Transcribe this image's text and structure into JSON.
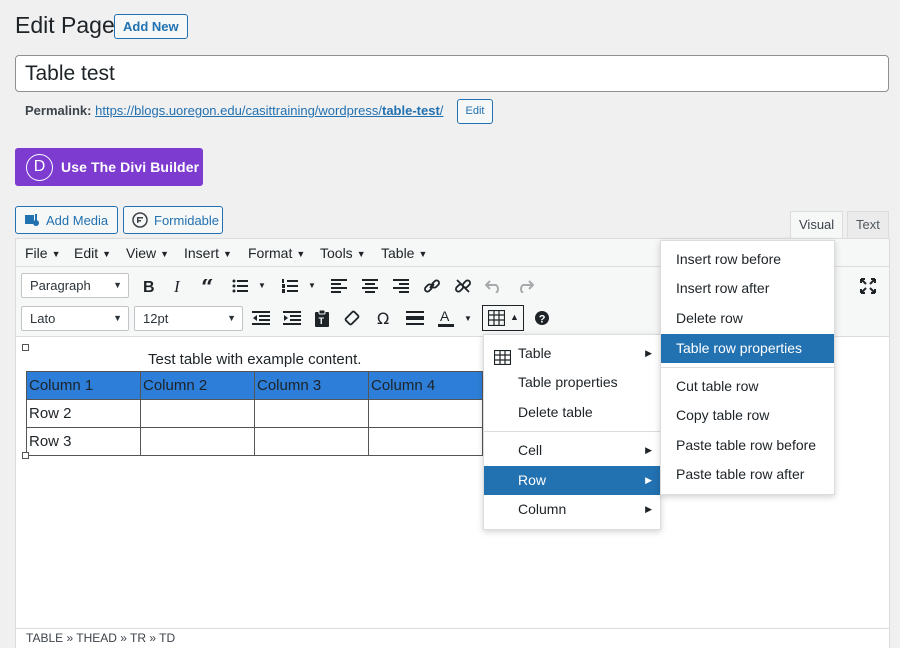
{
  "header": {
    "title": "Edit Page",
    "add_new_label": "Add New"
  },
  "post": {
    "title_value": "Table test",
    "permalink_label": "Permalink:",
    "permalink_base": "https://blogs.uoregon.edu/casittraining/wordpress/",
    "permalink_slug": "table-test",
    "permalink_trailing": "/",
    "edit_slug_label": "Edit"
  },
  "divi": {
    "logo_letter": "D",
    "label": "Use The Divi Builder",
    "color": "#7e3bd0"
  },
  "media_buttons": {
    "add_media": "Add Media",
    "formidable": "Formidable"
  },
  "editor_tabs": {
    "visual": "Visual",
    "text": "Text"
  },
  "menubar": {
    "items": [
      "File",
      "Edit",
      "View",
      "Insert",
      "Format",
      "Tools",
      "Table"
    ]
  },
  "toolbar": {
    "format_select": "Paragraph",
    "font_family_select": "Lato",
    "font_size_select": "12pt"
  },
  "content": {
    "caption": "Test table with example content.",
    "rows": [
      [
        "Column 1",
        "Column 2",
        "Column 3",
        "Column 4"
      ],
      [
        "Row 2",
        "",
        "",
        ""
      ],
      [
        "Row 3",
        "",
        "",
        ""
      ]
    ],
    "header_color": "#2d7ed8"
  },
  "table_menu": {
    "items": [
      {
        "label": "Table",
        "icon": "table-icon",
        "has_submenu": true
      },
      {
        "label": "Table properties"
      },
      {
        "label": "Delete table"
      },
      {
        "label": "Cell",
        "has_submenu": true
      },
      {
        "label": "Row",
        "has_submenu": true,
        "selected": true
      },
      {
        "label": "Column",
        "has_submenu": true
      }
    ]
  },
  "row_submenu": {
    "items": [
      {
        "label": "Insert row before"
      },
      {
        "label": "Insert row after"
      },
      {
        "label": "Delete row"
      },
      {
        "label": "Table row properties",
        "selected": true
      },
      {
        "label": "Cut table row"
      },
      {
        "label": "Copy table row"
      },
      {
        "label": "Paste table row before"
      },
      {
        "label": "Paste table row after"
      }
    ]
  },
  "statusbar": {
    "path": "TABLE » THEAD » TR » TD"
  },
  "colors": {
    "accent": "#2271b1",
    "selected_bg": "#2271b1"
  }
}
